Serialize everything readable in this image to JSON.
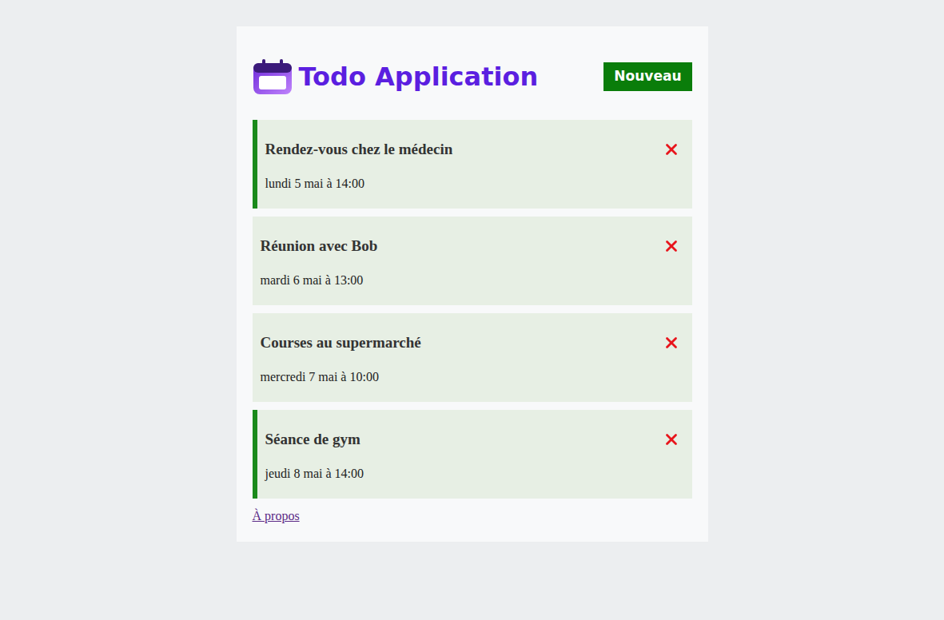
{
  "header": {
    "title": "Todo Application",
    "new_button": "Nouveau"
  },
  "todos": [
    {
      "title": "Rendez-vous chez le médecin",
      "date": "lundi 5 mai à 14:00",
      "reminder": true
    },
    {
      "title": "Réunion avec Bob",
      "date": "mardi 6 mai à 13:00",
      "reminder": false
    },
    {
      "title": "Courses au supermarché",
      "date": "mercredi 7 mai à 10:00",
      "reminder": false
    },
    {
      "title": "Séance de gym",
      "date": "jeudi 8 mai à 14:00",
      "reminder": true
    }
  ],
  "footer": {
    "link": "À propos"
  }
}
